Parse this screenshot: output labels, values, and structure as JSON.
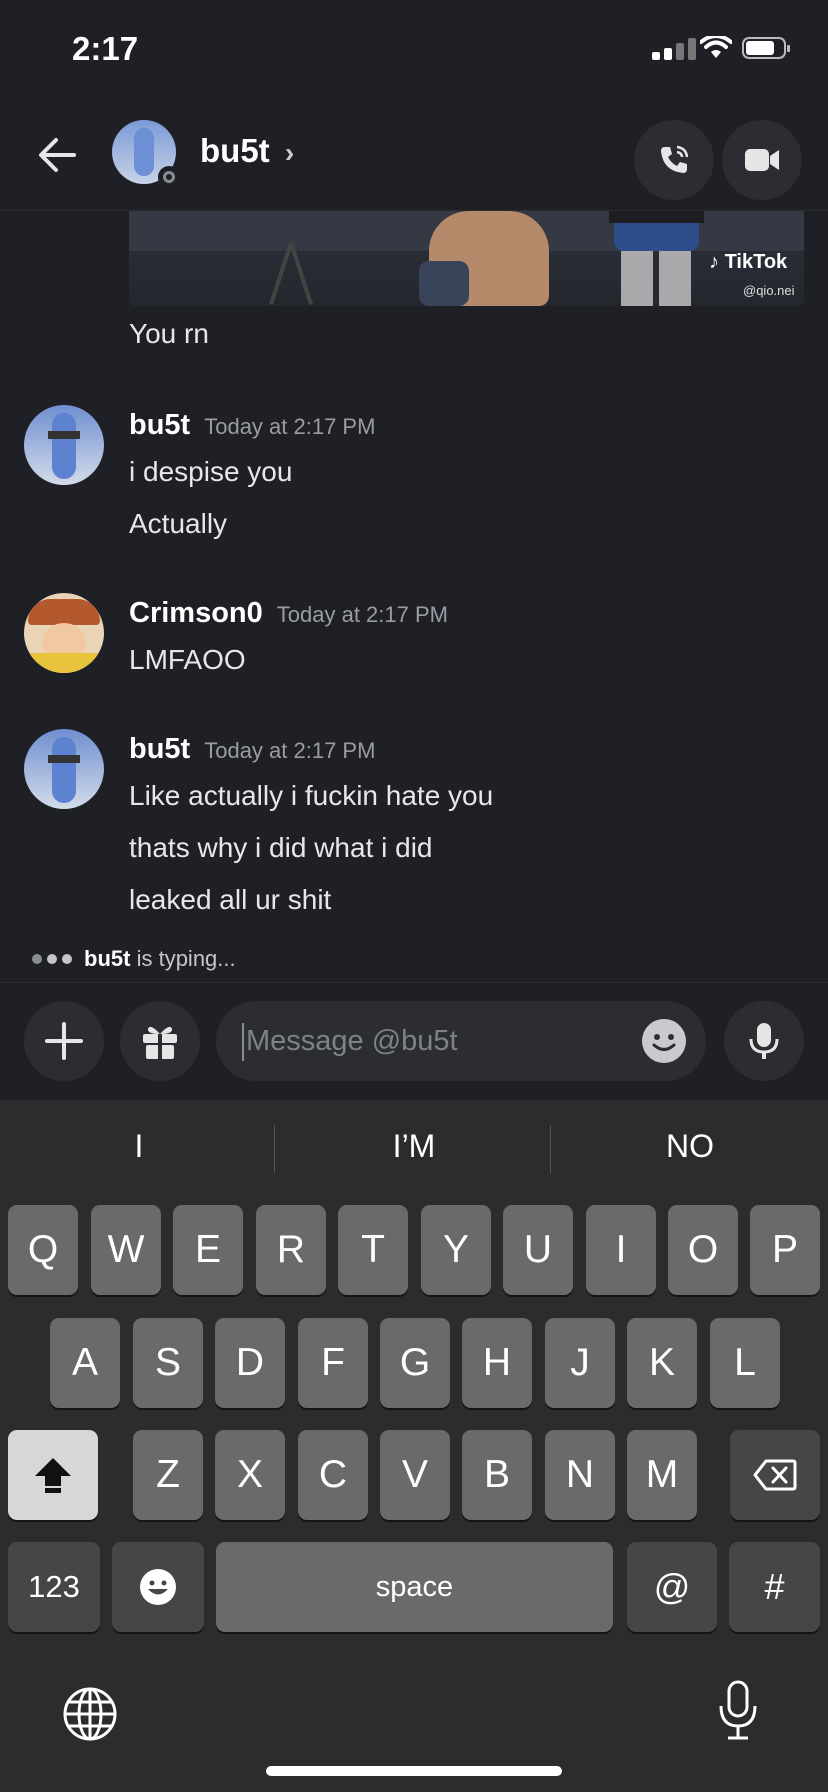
{
  "status_bar": {
    "time": "2:17"
  },
  "header": {
    "username": "bu5t",
    "chevron": "›"
  },
  "embed": {
    "brand": "TikTok",
    "handle": "@qio.nei"
  },
  "messages": [
    {
      "lines": [
        "You rn"
      ]
    },
    {
      "username": "bu5t",
      "timestamp": "Today at 2:17 PM",
      "lines": [
        "i despise you",
        "Actually"
      ]
    },
    {
      "username": "Crimson0",
      "timestamp": "Today at 2:17 PM",
      "lines": [
        "LMFAOO"
      ]
    },
    {
      "username": "bu5t",
      "timestamp": "Today at 2:17 PM",
      "lines": [
        "Like actually i fuckin hate you",
        "thats why i did what i did",
        "leaked all ur shit"
      ]
    }
  ],
  "typing": {
    "user": "bu5t",
    "text": "is typing..."
  },
  "composer": {
    "placeholder": "Message @bu5t"
  },
  "suggestions": [
    "I",
    "I’M",
    "NO"
  ],
  "keyboard": {
    "row1": [
      "Q",
      "W",
      "E",
      "R",
      "T",
      "Y",
      "U",
      "I",
      "O",
      "P"
    ],
    "row2": [
      "A",
      "S",
      "D",
      "F",
      "G",
      "H",
      "J",
      "K",
      "L"
    ],
    "row3": [
      "Z",
      "X",
      "C",
      "V",
      "B",
      "N",
      "M"
    ],
    "numbers": "123",
    "space": "space",
    "at": "@",
    "hash": "#"
  },
  "colors": {
    "background": "#1f2026",
    "keyboard": "#2c2c2e",
    "key": "#6a6a6d"
  }
}
